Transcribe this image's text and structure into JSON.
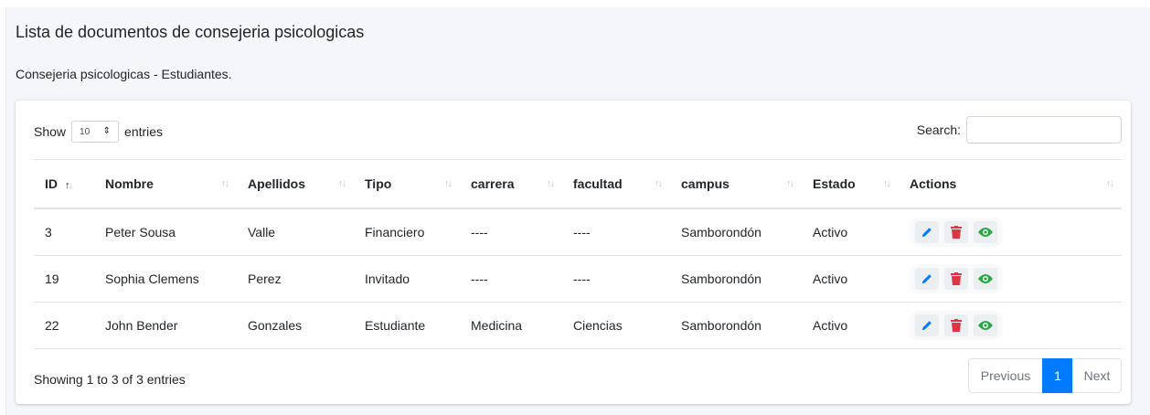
{
  "header": {
    "title": "Lista de documentos de consejeria psicologicas",
    "subtitle": "Consejeria psicologicas - Estudiantes."
  },
  "controls": {
    "show_label": "Show",
    "entries_value": "10",
    "entries_label": "entries",
    "search_label": "Search:",
    "search_value": ""
  },
  "table": {
    "columns": [
      "ID",
      "Nombre",
      "Apellidos",
      "Tipo",
      "carrera",
      "facultad",
      "campus",
      "Estado",
      "Actions"
    ],
    "rows": [
      {
        "id": "3",
        "nombre": "Peter Sousa",
        "apellidos": "Valle",
        "tipo": "Financiero",
        "carrera": "----",
        "facultad": "----",
        "campus": "Samborondón",
        "estado": "Activo"
      },
      {
        "id": "19",
        "nombre": "Sophia Clemens",
        "apellidos": "Perez",
        "tipo": "Invitado",
        "carrera": "----",
        "facultad": "----",
        "campus": "Samborondón",
        "estado": "Activo"
      },
      {
        "id": "22",
        "nombre": "John Bender",
        "apellidos": "Gonzales",
        "tipo": "Estudiante",
        "carrera": "Medicina",
        "facultad": "Ciencias",
        "campus": "Samborondón",
        "estado": "Activo"
      }
    ],
    "action_icons": [
      "pencil-icon",
      "trash-icon",
      "eye-icon"
    ]
  },
  "footer": {
    "info": "Showing 1 to 3 of 3 entries",
    "prev_label": "Previous",
    "current_page": "1",
    "next_label": "Next"
  },
  "colors": {
    "edit": "#007bff",
    "delete": "#dc3545",
    "view": "#28a745",
    "page_active": "#007bff"
  }
}
